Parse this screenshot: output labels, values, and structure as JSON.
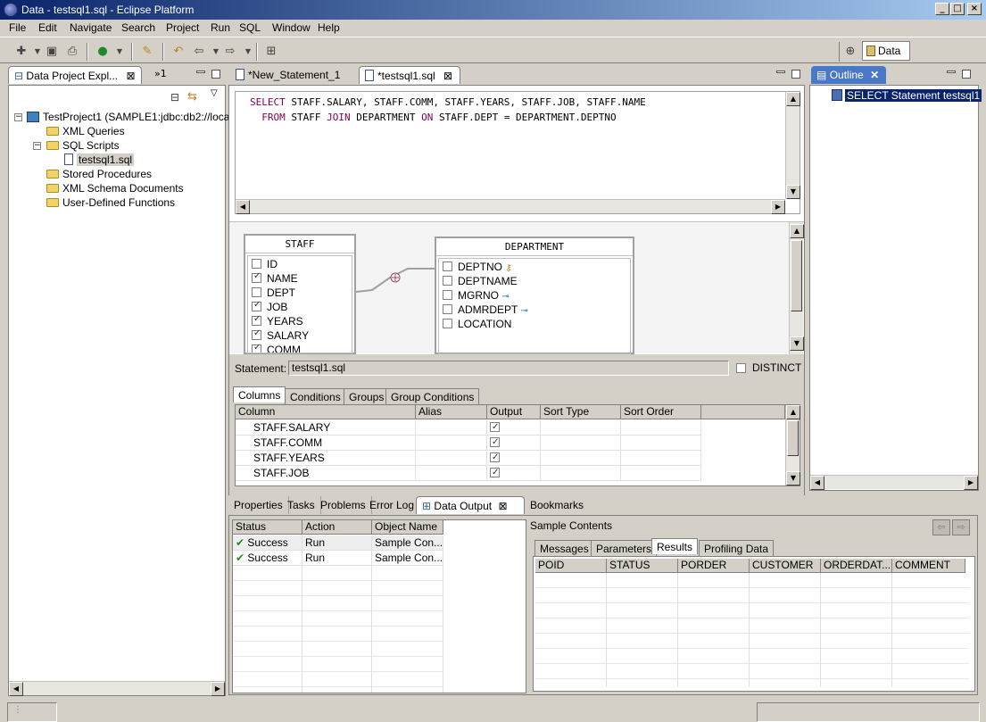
{
  "window": {
    "title": "Data - testsql1.sql - Eclipse Platform"
  },
  "menu": [
    "File",
    "Edit",
    "Navigate",
    "Search",
    "Project",
    "Run",
    "SQL",
    "Window",
    "Help"
  ],
  "perspective": {
    "label": "Data"
  },
  "explorer": {
    "tab": "Data Project Expl...",
    "overflow": "»1",
    "project": "TestProject1 (SAMPLE1:jdbc:db2://loca",
    "items": [
      "XML Queries",
      "SQL Scripts",
      "testsql1.sql",
      "Stored Procedures",
      "XML Schema Documents",
      "User-Defined Functions"
    ]
  },
  "editor": {
    "tabs": [
      "*New_Statement_1",
      "*testsql1.sql"
    ],
    "sql": {
      "line1": {
        "kw": "SELECT",
        "rest": " STAFF.SALARY, STAFF.COMM, STAFF.YEARS, STAFF.JOB, STAFF.NAME"
      },
      "line2": {
        "kw1": "FROM",
        "mid1": " STAFF ",
        "kw2": "JOIN",
        "mid2": " DEPARTMENT ",
        "kw3": "ON",
        "rest": " STAFF.DEPT = DEPARTMENT.DEPTNO"
      }
    },
    "diagram": {
      "staff": {
        "name": "STAFF",
        "columns": [
          {
            "label": "ID",
            "checked": false
          },
          {
            "label": "NAME",
            "checked": true
          },
          {
            "label": "DEPT",
            "checked": false
          },
          {
            "label": "JOB",
            "checked": true
          },
          {
            "label": "YEARS",
            "checked": true
          },
          {
            "label": "SALARY",
            "checked": true
          },
          {
            "label": "COMM",
            "checked": true
          }
        ]
      },
      "department": {
        "name": "DEPARTMENT",
        "columns": [
          {
            "label": "DEPTNO",
            "checked": false
          },
          {
            "label": "DEPTNAME",
            "checked": false
          },
          {
            "label": "MGRNO",
            "checked": false
          },
          {
            "label": "ADMRDEPT",
            "checked": false
          },
          {
            "label": "LOCATION",
            "checked": false
          }
        ]
      }
    },
    "statement": {
      "label": "Statement:",
      "value": "testsql1.sql",
      "distinct_label": "DISTINCT"
    },
    "subtabs": [
      "Columns",
      "Conditions",
      "Groups",
      "Group Conditions"
    ],
    "grid": {
      "headers": [
        "Column",
        "Alias",
        "Output",
        "Sort Type",
        "Sort Order"
      ],
      "rows": [
        "STAFF.SALARY",
        "STAFF.COMM",
        "STAFF.YEARS",
        "STAFF.JOB"
      ]
    }
  },
  "outline": {
    "tab": "Outline",
    "item": "SELECT Statement  testsql1"
  },
  "bottom": {
    "tabs": [
      "Properties",
      "Tasks",
      "Problems",
      "Error Log",
      "Data Output",
      "Bookmarks"
    ],
    "status_grid": {
      "headers": [
        "Status",
        "Action",
        "Object Name"
      ],
      "rows": [
        {
          "status": "Success",
          "action": "Run",
          "object": "Sample Con..."
        },
        {
          "status": "Success",
          "action": "Run",
          "object": "Sample Con..."
        }
      ]
    },
    "contents_title": "Sample Contents",
    "result_tabs": [
      "Messages",
      "Parameters",
      "Results",
      "Profiling Data"
    ],
    "result_headers": [
      "POID",
      "STATUS",
      "PORDER",
      "CUSTOMER",
      "ORDERDAT...",
      "COMMENT"
    ]
  }
}
